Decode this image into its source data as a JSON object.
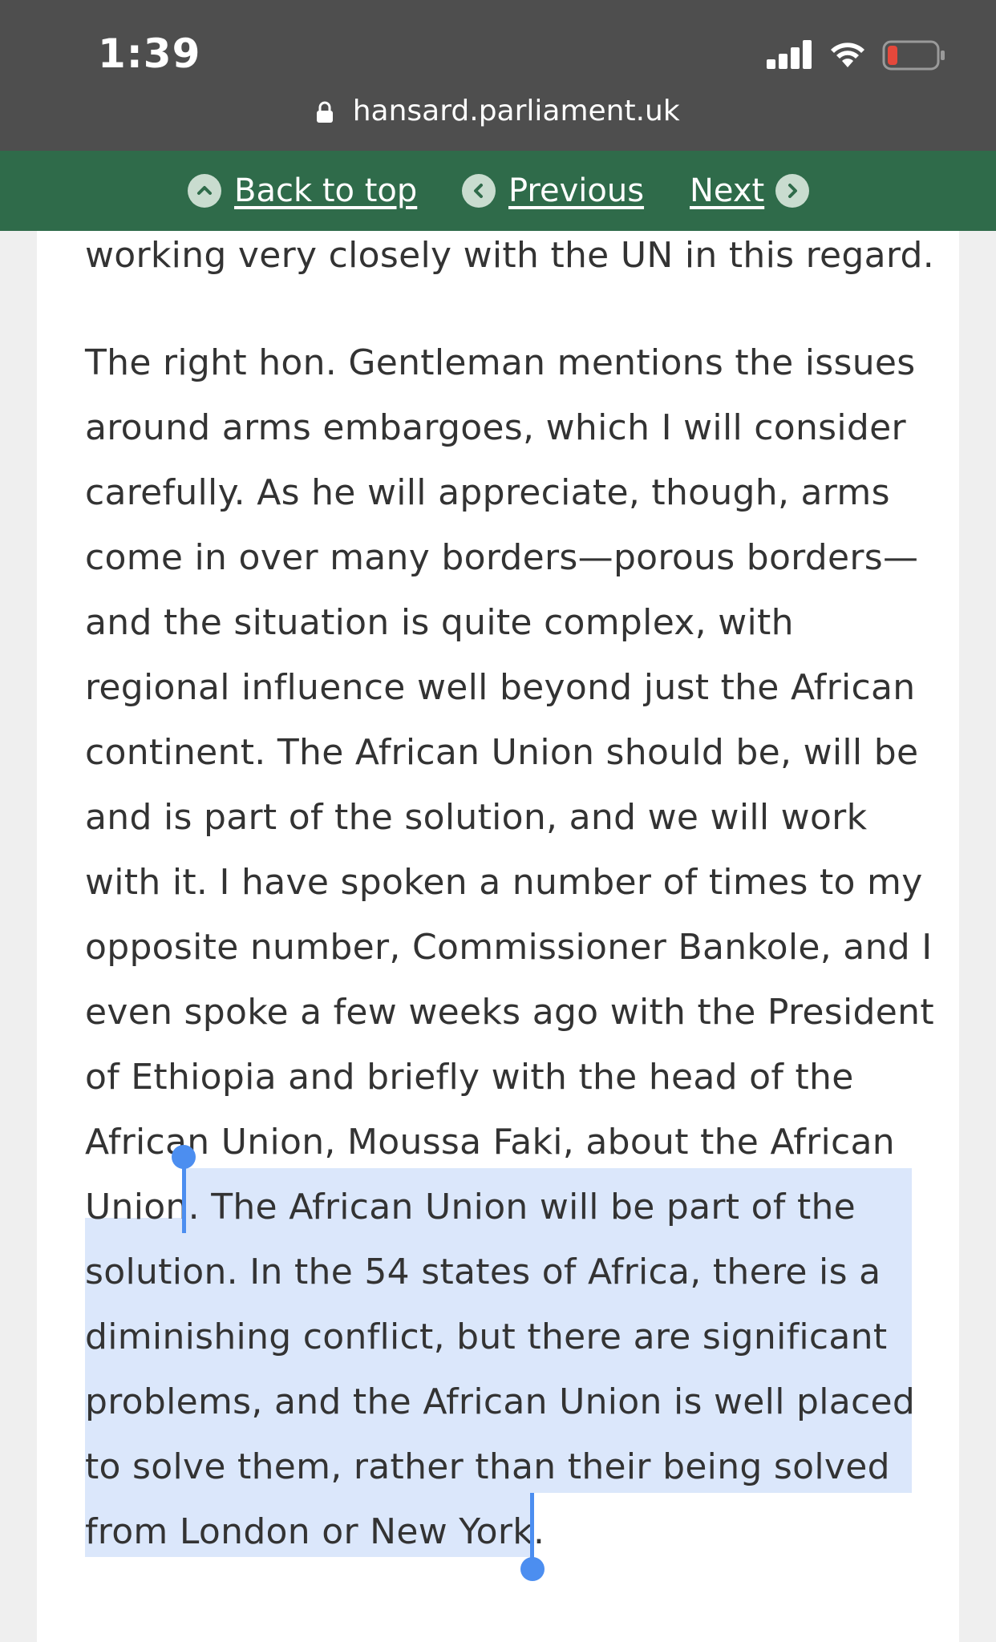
{
  "status_bar": {
    "time": "1:39",
    "icons": [
      "signal-icon",
      "wifi-icon",
      "battery-low-icon"
    ]
  },
  "browser": {
    "url": "hansard.parliament.uk"
  },
  "nav": {
    "back_to_top": "Back to top",
    "previous": "Previous",
    "next": "Next"
  },
  "content": {
    "fragment": "working very closely with the UN in this regard.",
    "lines": [
      "The right hon. Gentleman mentions the issues",
      "around arms embargoes, which I will consider",
      "carefully. As he will appreciate, though, arms",
      "come in over many borders—porous borders—",
      "and the situation is quite complex, with",
      "regional influence well beyond just the African",
      "continent. The African Union should be, will be",
      "and is part of the solution, and we will work",
      "with it. I have spoken a number of times to my",
      "opposite number, Commissioner Bankole, and I",
      "even spoke a few weeks ago with the President",
      "of Ethiopia and briefly with the head of the",
      "African Union, Moussa Faki, about the African",
      "Union. The African Union will be part of the",
      "solution. In the 54 states of Africa, there is a",
      "diminishing conflict, but there are significant",
      "problems, and the African Union is well placed",
      "to solve them, rather than their being solved",
      "from London or New York."
    ]
  },
  "colors": {
    "nav_green": "#2f6b4a",
    "selection": "#dbe7fb",
    "handle": "#4c8ef0"
  }
}
